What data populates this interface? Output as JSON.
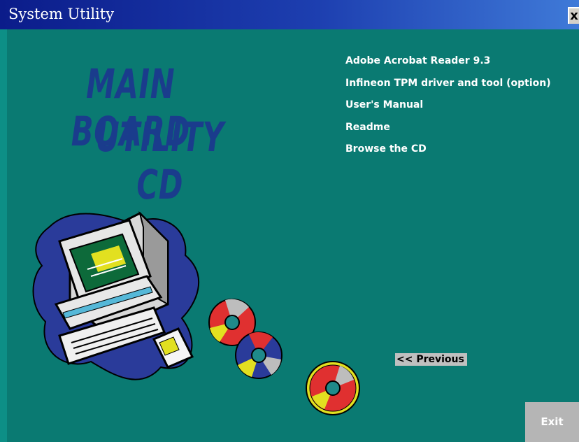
{
  "window": {
    "title": "System Utility",
    "close_glyph": "x"
  },
  "banner": {
    "line1": "MAIN BOARD",
    "line2": "UTILITY  CD"
  },
  "menu": {
    "items": [
      {
        "label": "Adobe Acrobat Reader 9.3"
      },
      {
        "label": "Infineon TPM driver and tool (option)"
      },
      {
        "label": "User's Manual"
      },
      {
        "label": "Readme"
      },
      {
        "label": "Browse the CD"
      }
    ]
  },
  "navigation": {
    "previous_label": "<< Previous"
  },
  "footer": {
    "exit_label": "Exit"
  },
  "colors": {
    "background": "#0a7a72",
    "titlebar": "#0b1c8a",
    "banner_text": "#1a3c8c",
    "menu_text": "#ffffff"
  },
  "illustration": {
    "icon": "computer-with-cds-clipart"
  }
}
